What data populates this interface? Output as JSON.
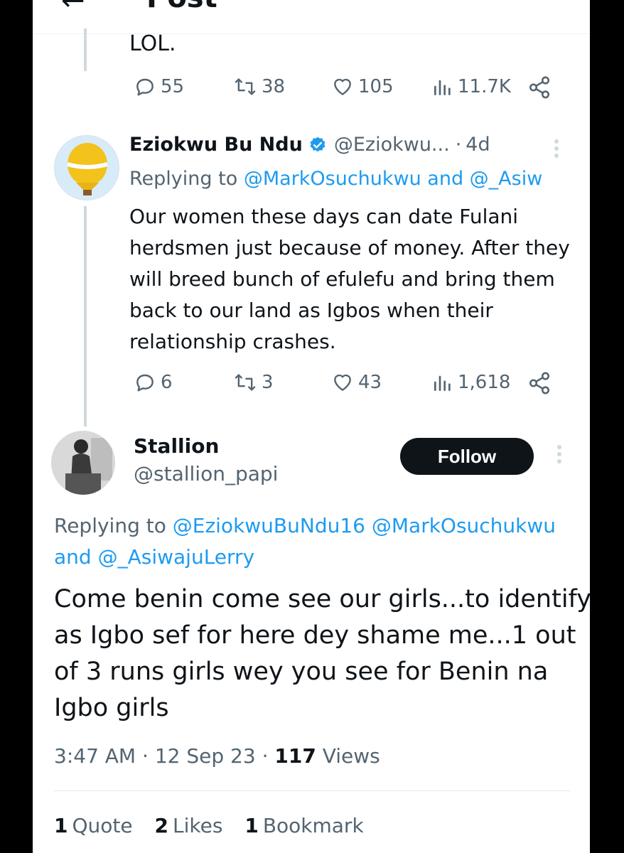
{
  "header": {
    "title": "Post",
    "back_icon": "arrow-left-icon"
  },
  "prev_tweet": {
    "text_tail": "LOL.",
    "actions": {
      "replies": "55",
      "reposts": "38",
      "likes": "105",
      "views": "11.7K"
    }
  },
  "reply_tweet": {
    "name": "Eziokwu Bu Ndu",
    "verified": true,
    "handle": "@Eziokwu...",
    "separator": "·",
    "age": "4d",
    "replying_prefix": "Replying to",
    "replying_mentions": "@MarkOsuchukwu and @_Asiw",
    "text": "Our women these days can date Fulani herdsmen just because of money. After they will breed bunch of efulefu and bring them back to our land as Igbos when their relationship crashes.",
    "actions": {
      "replies": "6",
      "reposts": "3",
      "likes": "43",
      "views": "1,618"
    }
  },
  "main_tweet": {
    "name": "Stallion",
    "handle": "@stallion_papi",
    "follow_label": "Follow",
    "replying_prefix": "Replying to",
    "replying_mentions_line1": "@EziokwuBuNdu16 @MarkOsuchukwu",
    "replying_and": "and",
    "replying_mentions_line2": "@_AsiwajuLerry",
    "text": "Come benin come see our girls...to identify as Igbo sef for here dey shame me...1 out of 3 runs girls wey you see for Benin na Igbo girls",
    "time": "3:47 AM",
    "sep": "·",
    "date": "12 Sep 23",
    "views_count": "117",
    "views_label": "Views",
    "stats": {
      "quotes_count": "1",
      "quotes_label": "Quote",
      "likes_count": "2",
      "likes_label": "Likes",
      "bookmarks_count": "1",
      "bookmarks_label": "Bookmark"
    }
  },
  "colors": {
    "accent": "#1d9bf0",
    "text": "#0f1419",
    "muted": "#536471",
    "button": "#0f1419"
  }
}
